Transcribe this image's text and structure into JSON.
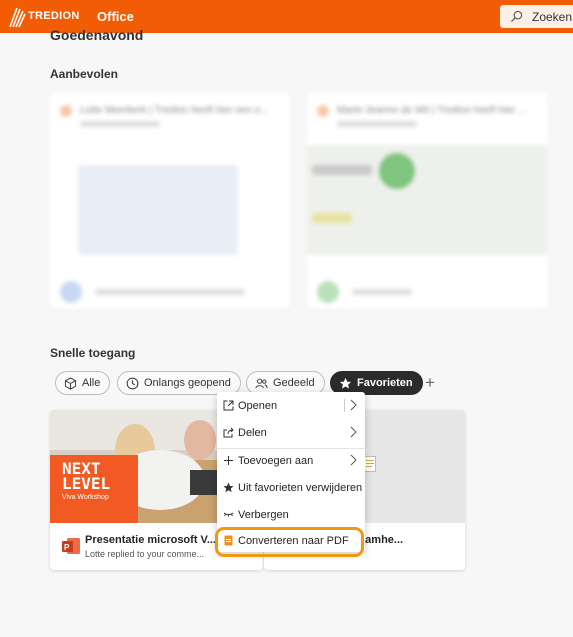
{
  "topbar": {
    "brand": "TREDION",
    "app_name": "Office",
    "search_label": "Zoeken",
    "logo_icon": "tredion-logo-icon",
    "accent_color": "#f25c05"
  },
  "main": {
    "greeting": "Goedenavond",
    "recommended_title": "Aanbevolen",
    "recommended_cards": [
      {
        "title": "Lotte Meerkerk | Tredion heeft hier een o..."
      },
      {
        "title": "Marie-Jeanne de Wit | Tredion heeft hier ..."
      }
    ],
    "quick_access_title": "Snelle toegang",
    "filters": [
      {
        "label": "Alle",
        "icon": "cube-icon",
        "active": false
      },
      {
        "label": "Onlangs geopend",
        "icon": "clock-icon",
        "active": false
      },
      {
        "label": "Gedeeld",
        "icon": "people-icon",
        "active": false
      },
      {
        "label": "Favorieten",
        "icon": "star-icon",
        "active": true
      }
    ],
    "add_filter": "+",
    "files": [
      {
        "name": "Presentatie microsoft V...",
        "activity": "Lotte replied to your comme...",
        "thumb_title_line1": "NEXT",
        "thumb_title_line2": "LEVEL",
        "thumb_subtitle": "Viva Workshop",
        "icon": "powerpoint-icon"
      },
      {
        "name": "...rkzaamhe...",
        "icon": "document-icon"
      }
    ]
  },
  "context_menu": {
    "items": [
      {
        "label": "Openen",
        "icon": "open-icon",
        "has_submenu": true
      },
      {
        "label": "Delen",
        "icon": "share-icon",
        "has_submenu": true
      },
      {
        "label": "Toevoegen aan",
        "icon": "plus-icon",
        "has_submenu": true
      },
      {
        "label": "Uit favorieten verwijderen",
        "icon": "star-filled-icon",
        "has_submenu": false
      },
      {
        "label": "Verbergen",
        "icon": "hide-icon",
        "has_submenu": false
      },
      {
        "label": "Converteren naar PDF",
        "icon": "pdf-icon",
        "has_submenu": false
      }
    ],
    "highlight_color": "#f0980f"
  }
}
